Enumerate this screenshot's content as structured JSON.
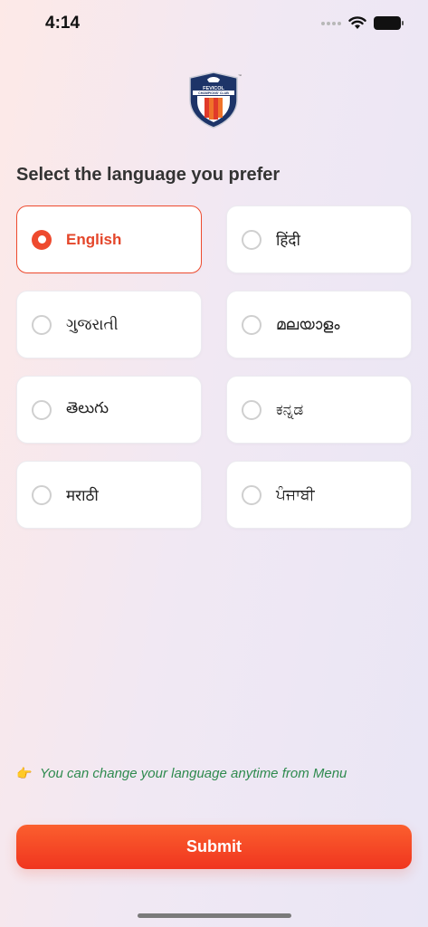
{
  "status_bar": {
    "time": "4:14"
  },
  "logo": {
    "text_top": "FEVICOL",
    "text_bottom": "CHAMPIONS' CLUB",
    "tm": "™"
  },
  "heading": "Select the language you prefer",
  "languages": [
    {
      "label": "English",
      "selected": true
    },
    {
      "label": "हिंदी",
      "selected": false
    },
    {
      "label": "ગુજરાતી",
      "selected": false
    },
    {
      "label": "മലയാളം",
      "selected": false
    },
    {
      "label": "తెలుగు",
      "selected": false
    },
    {
      "label": "ಕನ್ನಡ",
      "selected": false
    },
    {
      "label": "मराठी",
      "selected": false
    },
    {
      "label": "ਪੰਜਾਬੀ",
      "selected": false
    }
  ],
  "hint": {
    "icon": "👉",
    "text": "You can change your language anytime from Menu"
  },
  "submit_label": "Submit",
  "colors": {
    "accent": "#ee4a2e",
    "hint": "#2e8a4e"
  }
}
